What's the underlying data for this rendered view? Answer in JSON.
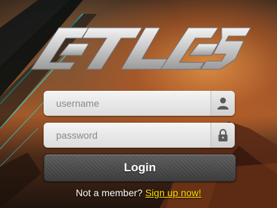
{
  "brand": {
    "logo_text": "ATLAS"
  },
  "form": {
    "username_placeholder": "username",
    "password_placeholder": "password",
    "username_icon": "user-icon",
    "password_icon": "lock-icon",
    "login_label": "Login"
  },
  "footer": {
    "prompt": "Not a member?",
    "signup_link": "Sign up now!"
  },
  "colors": {
    "link": "#ffe000",
    "accent_streak": "#1ee0e0"
  }
}
